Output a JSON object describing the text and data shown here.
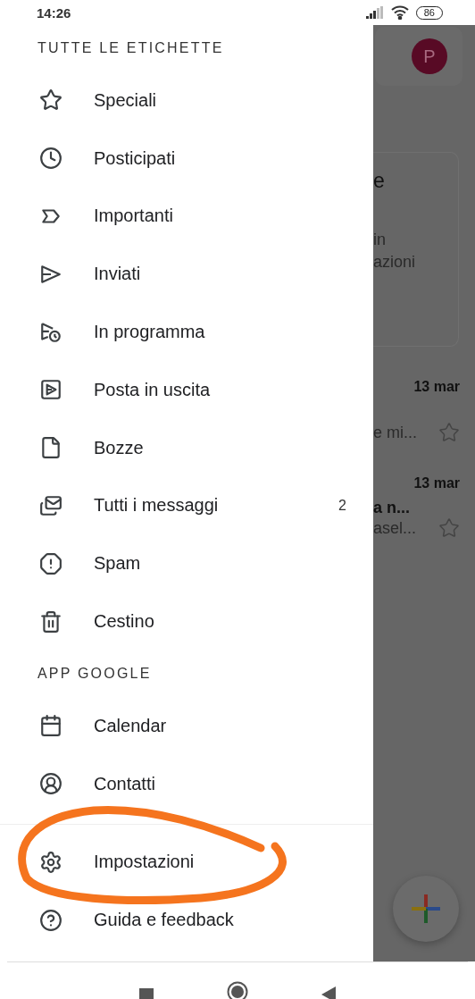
{
  "status_bar": {
    "time": "14:26",
    "battery": "86"
  },
  "drawer": {
    "sections": [
      {
        "title": "TUTTE LE ETICHETTE",
        "items": [
          {
            "label": "Speciali"
          },
          {
            "label": "Posticipati"
          },
          {
            "label": "Importanti"
          },
          {
            "label": "Inviati"
          },
          {
            "label": "In programma"
          },
          {
            "label": "Posta in uscita"
          },
          {
            "label": "Bozze"
          },
          {
            "label": "Tutti i messaggi",
            "count": "2"
          },
          {
            "label": "Spam"
          },
          {
            "label": "Cestino"
          }
        ]
      },
      {
        "title": "APP GOOGLE",
        "items": [
          {
            "label": "Calendar"
          },
          {
            "label": "Contatti"
          }
        ]
      },
      {
        "items": [
          {
            "label": "Impostazioni"
          },
          {
            "label": "Guida e feedback"
          }
        ]
      }
    ]
  },
  "background": {
    "avatar": "P",
    "promo_lines": [
      "e",
      "in",
      "azioni"
    ],
    "emails": [
      {
        "date": "13 mar",
        "lines": [
          "e mi..."
        ]
      },
      {
        "date": "13 mar",
        "lines": [
          "a n...",
          "asel..."
        ]
      }
    ]
  }
}
